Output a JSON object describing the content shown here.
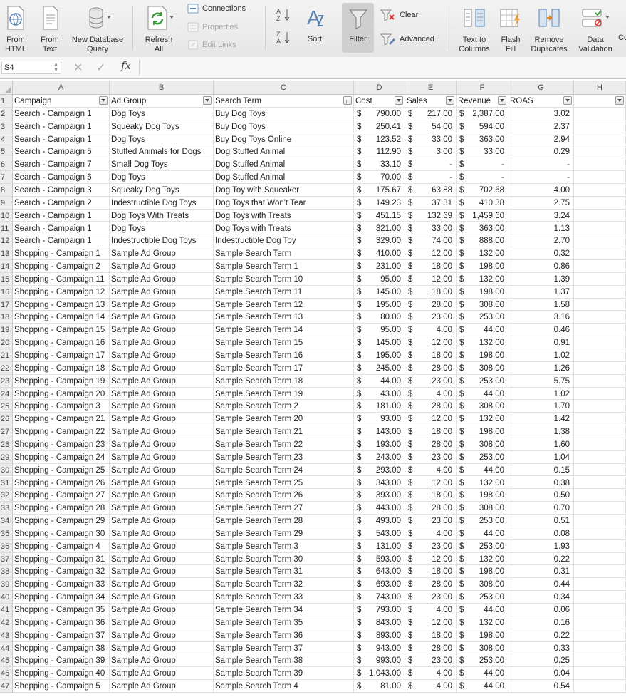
{
  "ribbon": {
    "from_html": "From\nHTML",
    "from_text": "From\nText",
    "new_db_query": "New Database\nQuery",
    "refresh_all": "Refresh\nAll",
    "connections": "Connections",
    "properties": "Properties",
    "edit_links": "Edit Links",
    "sort": "Sort",
    "filter": "Filter",
    "clear": "Clear",
    "advanced": "Advanced",
    "text_to_columns": "Text to\nColumns",
    "flash_fill": "Flash\nFill",
    "remove_duplicates": "Remove\nDuplicates",
    "data_validation": "Data\nValidation",
    "truncated": "Co"
  },
  "formula_bar": {
    "name_box": "S4",
    "fx": "fx",
    "formula": ""
  },
  "columns": [
    "A",
    "B",
    "C",
    "D",
    "E",
    "F",
    "G",
    "H"
  ],
  "header": [
    "Campaign",
    "Ad Group",
    "Search Term",
    "Cost",
    "Sales",
    "Revenue",
    "ROAS",
    ""
  ],
  "rows": [
    [
      "Search - Campaign 1",
      "Dog Toys",
      "Buy Dog Toys",
      "790.00",
      "217.00",
      "2,387.00",
      "3.02"
    ],
    [
      "Search - Campaign 1",
      "Squeaky Dog Toys",
      "Buy Dog Toys",
      "250.41",
      "54.00",
      "594.00",
      "2.37"
    ],
    [
      "Search - Campaign 1",
      "Dog Toys",
      "Buy Dog Toys Online",
      "123.52",
      "33.00",
      "363.00",
      "2.94"
    ],
    [
      "Search - Campaign 5",
      "Stuffed Animals for Dogs",
      "Dog Stuffed Animal",
      "112.90",
      "3.00",
      "33.00",
      "0.29"
    ],
    [
      "Search - Campaign 7",
      "Small Dog Toys",
      "Dog Stuffed Animal",
      "33.10",
      "-",
      "-",
      "-"
    ],
    [
      "Search - Campaign 6",
      "Dog Toys",
      "Dog Stuffed Animal",
      "70.00",
      "-",
      "-",
      "-"
    ],
    [
      "Search - Campaign 3",
      "Squeaky Dog Toys",
      "Dog Toy with Squeaker",
      "175.67",
      "63.88",
      "702.68",
      "4.00"
    ],
    [
      "Search - Campaign 2",
      "Indestructible Dog Toys",
      "Dog Toys that Won't Tear",
      "149.23",
      "37.31",
      "410.38",
      "2.75"
    ],
    [
      "Search - Campaign 1",
      "Dog Toys With Treats",
      "Dog Toys with Treats",
      "451.15",
      "132.69",
      "1,459.60",
      "3.24"
    ],
    [
      "Search - Campaign 1",
      "Dog Toys",
      "Dog Toys with Treats",
      "321.00",
      "33.00",
      "363.00",
      "1.13"
    ],
    [
      "Search - Campaign 1",
      "Indestructible Dog Toys",
      "Indestructible Dog Toy",
      "329.00",
      "74.00",
      "888.00",
      "2.70"
    ],
    [
      "Shopping - Campaign 1",
      "Sample Ad Group",
      "Sample Search Term",
      "410.00",
      "12.00",
      "132.00",
      "0.32"
    ],
    [
      "Shopping - Campaign 2",
      "Sample Ad Group",
      "Sample Search Term 1",
      "231.00",
      "18.00",
      "198.00",
      "0.86"
    ],
    [
      "Shopping - Campaign 11",
      "Sample Ad Group",
      "Sample Search Term 10",
      "95.00",
      "12.00",
      "132.00",
      "1.39"
    ],
    [
      "Shopping - Campaign 12",
      "Sample Ad Group",
      "Sample Search Term 11",
      "145.00",
      "18.00",
      "198.00",
      "1.37"
    ],
    [
      "Shopping - Campaign 13",
      "Sample Ad Group",
      "Sample Search Term 12",
      "195.00",
      "28.00",
      "308.00",
      "1.58"
    ],
    [
      "Shopping - Campaign 14",
      "Sample Ad Group",
      "Sample Search Term 13",
      "80.00",
      "23.00",
      "253.00",
      "3.16"
    ],
    [
      "Shopping - Campaign 15",
      "Sample Ad Group",
      "Sample Search Term 14",
      "95.00",
      "4.00",
      "44.00",
      "0.46"
    ],
    [
      "Shopping - Campaign 16",
      "Sample Ad Group",
      "Sample Search Term 15",
      "145.00",
      "12.00",
      "132.00",
      "0.91"
    ],
    [
      "Shopping - Campaign 17",
      "Sample Ad Group",
      "Sample Search Term 16",
      "195.00",
      "18.00",
      "198.00",
      "1.02"
    ],
    [
      "Shopping - Campaign 18",
      "Sample Ad Group",
      "Sample Search Term 17",
      "245.00",
      "28.00",
      "308.00",
      "1.26"
    ],
    [
      "Shopping - Campaign 19",
      "Sample Ad Group",
      "Sample Search Term 18",
      "44.00",
      "23.00",
      "253.00",
      "5.75"
    ],
    [
      "Shopping - Campaign 20",
      "Sample Ad Group",
      "Sample Search Term 19",
      "43.00",
      "4.00",
      "44.00",
      "1.02"
    ],
    [
      "Shopping - Campaign 3",
      "Sample Ad Group",
      "Sample Search Term 2",
      "181.00",
      "28.00",
      "308.00",
      "1.70"
    ],
    [
      "Shopping - Campaign 21",
      "Sample Ad Group",
      "Sample Search Term 20",
      "93.00",
      "12.00",
      "132.00",
      "1.42"
    ],
    [
      "Shopping - Campaign 22",
      "Sample Ad Group",
      "Sample Search Term 21",
      "143.00",
      "18.00",
      "198.00",
      "1.38"
    ],
    [
      "Shopping - Campaign 23",
      "Sample Ad Group",
      "Sample Search Term 22",
      "193.00",
      "28.00",
      "308.00",
      "1.60"
    ],
    [
      "Shopping - Campaign 24",
      "Sample Ad Group",
      "Sample Search Term 23",
      "243.00",
      "23.00",
      "253.00",
      "1.04"
    ],
    [
      "Shopping - Campaign 25",
      "Sample Ad Group",
      "Sample Search Term 24",
      "293.00",
      "4.00",
      "44.00",
      "0.15"
    ],
    [
      "Shopping - Campaign 26",
      "Sample Ad Group",
      "Sample Search Term 25",
      "343.00",
      "12.00",
      "132.00",
      "0.38"
    ],
    [
      "Shopping - Campaign 27",
      "Sample Ad Group",
      "Sample Search Term 26",
      "393.00",
      "18.00",
      "198.00",
      "0.50"
    ],
    [
      "Shopping - Campaign 28",
      "Sample Ad Group",
      "Sample Search Term 27",
      "443.00",
      "28.00",
      "308.00",
      "0.70"
    ],
    [
      "Shopping - Campaign 29",
      "Sample Ad Group",
      "Sample Search Term 28",
      "493.00",
      "23.00",
      "253.00",
      "0.51"
    ],
    [
      "Shopping - Campaign 30",
      "Sample Ad Group",
      "Sample Search Term 29",
      "543.00",
      "4.00",
      "44.00",
      "0.08"
    ],
    [
      "Shopping - Campaign 4",
      "Sample Ad Group",
      "Sample Search Term 3",
      "131.00",
      "23.00",
      "253.00",
      "1.93"
    ],
    [
      "Shopping - Campaign 31",
      "Sample Ad Group",
      "Sample Search Term 30",
      "593.00",
      "12.00",
      "132.00",
      "0.22"
    ],
    [
      "Shopping - Campaign 32",
      "Sample Ad Group",
      "Sample Search Term 31",
      "643.00",
      "18.00",
      "198.00",
      "0.31"
    ],
    [
      "Shopping - Campaign 33",
      "Sample Ad Group",
      "Sample Search Term 32",
      "693.00",
      "28.00",
      "308.00",
      "0.44"
    ],
    [
      "Shopping - Campaign 34",
      "Sample Ad Group",
      "Sample Search Term 33",
      "743.00",
      "23.00",
      "253.00",
      "0.34"
    ],
    [
      "Shopping - Campaign 35",
      "Sample Ad Group",
      "Sample Search Term 34",
      "793.00",
      "4.00",
      "44.00",
      "0.06"
    ],
    [
      "Shopping - Campaign 36",
      "Sample Ad Group",
      "Sample Search Term 35",
      "843.00",
      "12.00",
      "132.00",
      "0.16"
    ],
    [
      "Shopping - Campaign 37",
      "Sample Ad Group",
      "Sample Search Term 36",
      "893.00",
      "18.00",
      "198.00",
      "0.22"
    ],
    [
      "Shopping - Campaign 38",
      "Sample Ad Group",
      "Sample Search Term 37",
      "943.00",
      "28.00",
      "308.00",
      "0.33"
    ],
    [
      "Shopping - Campaign 39",
      "Sample Ad Group",
      "Sample Search Term 38",
      "993.00",
      "23.00",
      "253.00",
      "0.25"
    ],
    [
      "Shopping - Campaign 40",
      "Sample Ad Group",
      "Sample Search Term 39",
      "1,043.00",
      "4.00",
      "44.00",
      "0.04"
    ],
    [
      "Shopping - Campaign 5",
      "Sample Ad Group",
      "Sample Search Term 4",
      "81.00",
      "4.00",
      "44.00",
      "0.54"
    ]
  ],
  "currency_symbol": "$",
  "colors": {
    "accent_green": "#3c9a3c",
    "header_bg": "#ececec"
  }
}
